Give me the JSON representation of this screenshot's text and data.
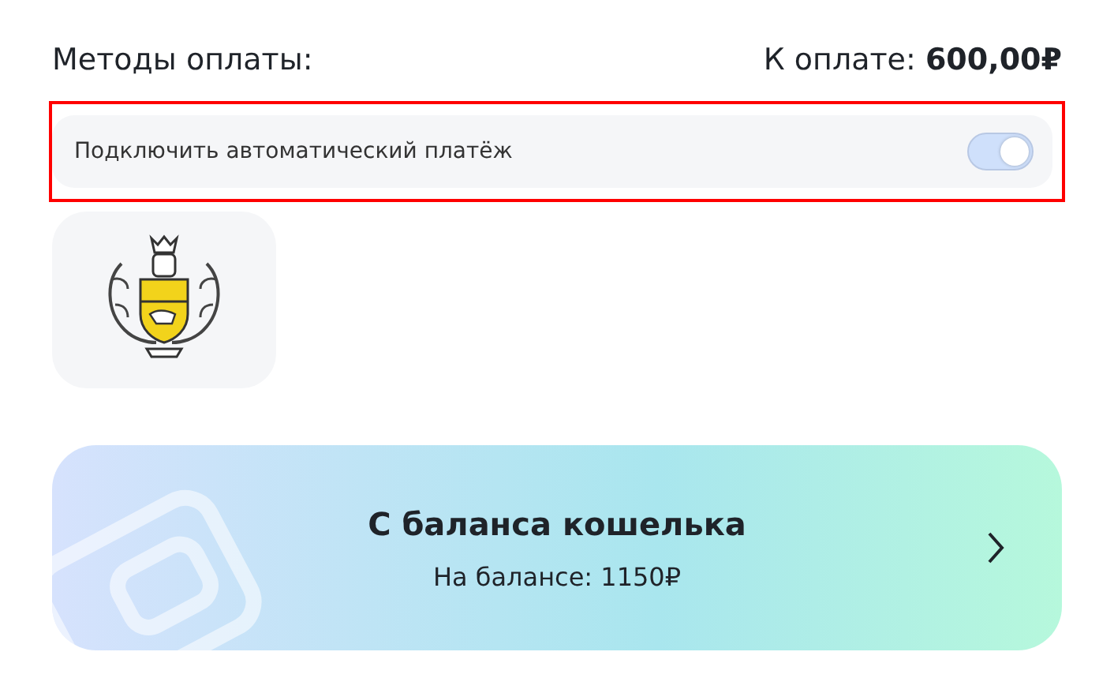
{
  "header": {
    "title": "Методы оплаты:",
    "amount_label": "К оплате:",
    "amount": "600,00₽"
  },
  "autopay": {
    "label": "Подключить автоматический платёж",
    "on": true,
    "highlighted": true
  },
  "methods": [
    {
      "kind": "bank"
    }
  ],
  "wallet": {
    "title": "С баланса кошелька",
    "balance": "На балансе: 1150₽"
  }
}
